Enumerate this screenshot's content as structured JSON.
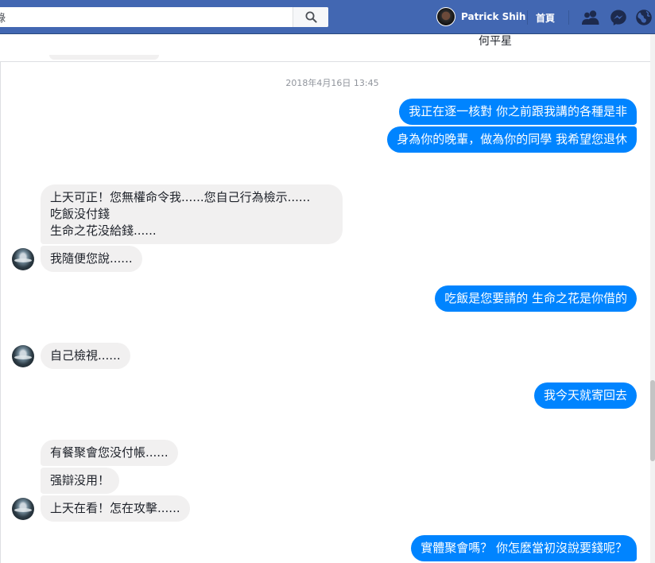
{
  "search": {
    "value": "錄"
  },
  "user": {
    "name": "Patrick Shih"
  },
  "nav": {
    "home": "首頁"
  },
  "conversation": {
    "partial_name": "何平星",
    "timestamp": "2018年4月16日 13:45"
  },
  "messages": [
    {
      "from": "me",
      "text": "我正在逐一核對 你之前跟我講的各種是非"
    },
    {
      "from": "me",
      "text": "身為你的晚輩，做為你的同學 我希望您退休"
    },
    {
      "from": "them",
      "lines": [
        "上天可正！您無權命令我......您自己行為檢示......",
        "吃飯没付錢",
        "生命之花没給錢......"
      ]
    },
    {
      "from": "them",
      "text": "我隨便您說......"
    },
    {
      "from": "me",
      "text": "吃飯是您要請的 生命之花是你借的"
    },
    {
      "from": "them",
      "text": "自己檢視......"
    },
    {
      "from": "me",
      "text": "我今天就寄回去"
    },
    {
      "from": "them",
      "text": "有餐聚會您没付帳......"
    },
    {
      "from": "them",
      "text": "强辯没用！"
    },
    {
      "from": "them",
      "text": "上天在看！怎在攻擊......"
    },
    {
      "from": "me",
      "text": "實體聚會嗎？ 你怎麼當初沒說要錢呢？"
    }
  ],
  "icons": {
    "search": "search-icon",
    "friends": "friend-requests-icon",
    "messenger": "messenger-icon",
    "notifications": "globe-notifications-icon"
  },
  "colors": {
    "topbar": "#4267b2",
    "outgoing_bubble": "#0084ff",
    "incoming_bubble": "#f1f0f0"
  }
}
